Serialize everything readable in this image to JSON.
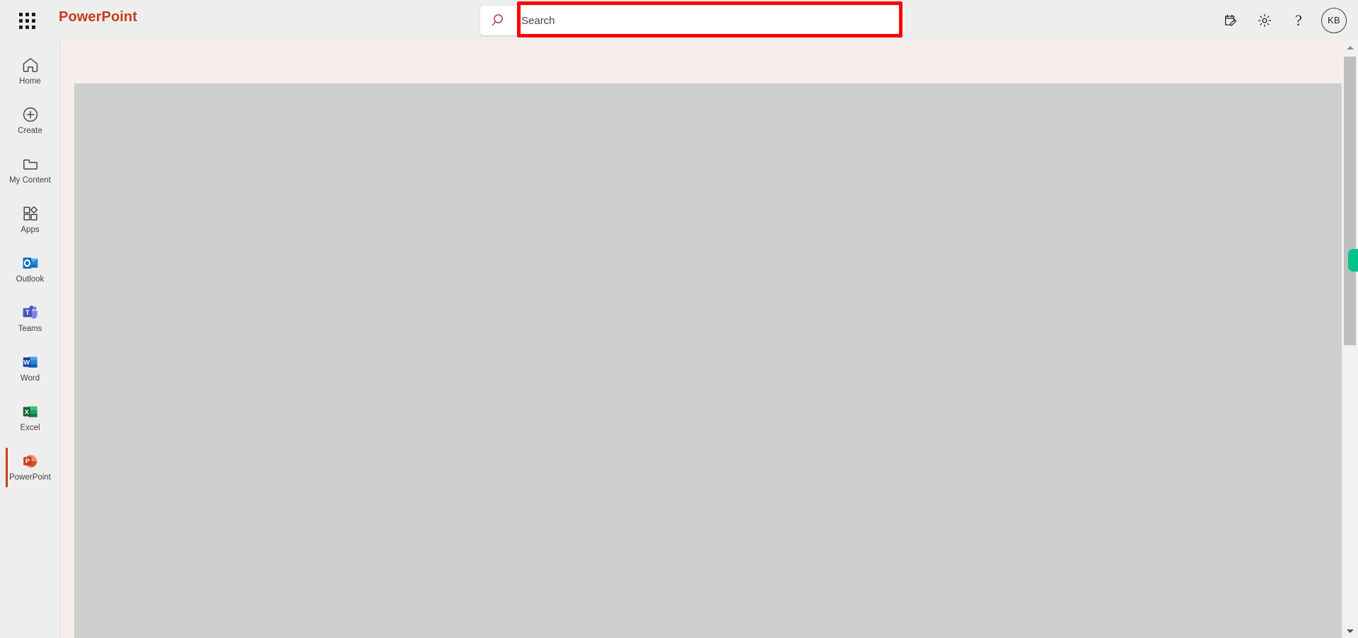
{
  "header": {
    "app_launcher": "app-launcher",
    "brand": "PowerPoint",
    "brand_color": "#c43e1c",
    "search": {
      "placeholder": "Search",
      "value": "",
      "icon": "search-icon",
      "highlighted": true,
      "highlight_color": "#fe0000"
    },
    "actions": [
      {
        "name": "note-check-icon",
        "label": ""
      },
      {
        "name": "gear-icon",
        "label": ""
      },
      {
        "name": "help-icon",
        "label": "?"
      }
    ],
    "avatar": {
      "initials": "KB",
      "name": "account-avatar"
    }
  },
  "sidebar": {
    "items": [
      {
        "label": "Home",
        "icon": "home-icon",
        "active": false
      },
      {
        "label": "Create",
        "icon": "create-plus-icon",
        "active": false
      },
      {
        "label": "My Content",
        "icon": "folder-icon",
        "active": false
      },
      {
        "label": "Apps",
        "icon": "apps-grid-icon",
        "active": false
      },
      {
        "label": "Outlook",
        "icon": "outlook-icon",
        "active": false
      },
      {
        "label": "Teams",
        "icon": "teams-icon",
        "active": false
      },
      {
        "label": "Word",
        "icon": "word-icon",
        "active": false
      },
      {
        "label": "Excel",
        "icon": "excel-icon",
        "active": false
      },
      {
        "label": "PowerPoint",
        "icon": "powerpoint-icon",
        "active": true
      }
    ]
  },
  "main": {
    "canvas_color": "#f7eeec",
    "panel_color": "#cfcfcf"
  },
  "scrollbar": {
    "thumb_color": "#bebebe",
    "track_color": "#f1f1f1",
    "cursor_color": "#00c48c"
  }
}
